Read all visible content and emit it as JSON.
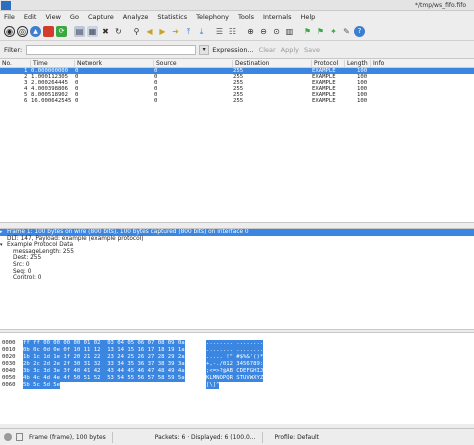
{
  "window": {
    "title": "*/tmp/ws_fifo.fifo"
  },
  "menu": [
    "File",
    "Edit",
    "View",
    "Go",
    "Capture",
    "Analyze",
    "Statistics",
    "Telephony",
    "Tools",
    "Internals",
    "Help"
  ],
  "toolbar": {
    "icons": [
      "interfaces-icon",
      "options-icon",
      "start-icon",
      "stop-icon",
      "restart-icon",
      "open-icon",
      "save-icon",
      "close-icon",
      "reload-icon",
      "print-icon",
      "find-icon",
      "back-icon",
      "forward-icon",
      "goto-icon",
      "first-icon",
      "last-icon",
      "colorize-icon",
      "autoscroll-icon",
      "zoom-in-icon",
      "zoom-out-icon",
      "zoom-100-icon",
      "resize-columns-icon",
      "capture-filters-icon",
      "display-filters-icon",
      "coloring-rules-icon",
      "preferences-icon",
      "help-icon"
    ],
    "colors": {
      "accent": "#2a6fc0",
      "stop": "#d23c2c",
      "start": "#3a7fd0",
      "green": "#3aa840"
    }
  },
  "filter": {
    "label": "Filter:",
    "value": "",
    "expression": "Expression...",
    "clear": "Clear",
    "apply": "Apply",
    "save": "Save"
  },
  "packet_list": {
    "columns": [
      "No.",
      "Time",
      "Network",
      "Source",
      "Destination",
      "Protocol",
      "Length",
      "Info"
    ],
    "rows": [
      {
        "no": "1",
        "time": "0.000000000",
        "network": "0",
        "source": "0",
        "destination": "255",
        "protocol": "EXAMPLE",
        "length": "100",
        "info": ""
      },
      {
        "no": "2",
        "time": "1.000112305",
        "network": "0",
        "source": "0",
        "destination": "255",
        "protocol": "EXAMPLE",
        "length": "100",
        "info": ""
      },
      {
        "no": "3",
        "time": "2.000264445",
        "network": "0",
        "source": "0",
        "destination": "255",
        "protocol": "EXAMPLE",
        "length": "100",
        "info": ""
      },
      {
        "no": "4",
        "time": "4.000398806",
        "network": "0",
        "source": "0",
        "destination": "255",
        "protocol": "EXAMPLE",
        "length": "100",
        "info": ""
      },
      {
        "no": "5",
        "time": "8.000518902",
        "network": "0",
        "source": "0",
        "destination": "255",
        "protocol": "EXAMPLE",
        "length": "100",
        "info": ""
      },
      {
        "no": "6",
        "time": "16.000642545",
        "network": "0",
        "source": "0",
        "destination": "255",
        "protocol": "EXAMPLE",
        "length": "100",
        "info": ""
      }
    ]
  },
  "details": {
    "lines": [
      {
        "text": "Frame 1: 100 bytes on wire (800 bits), 100 bytes captured (800 bits) on interface 0",
        "tri": "▸",
        "indent": 0
      },
      {
        "text": "DLT: 147, Payload: example (example protocol)",
        "tri": "",
        "indent": 1
      },
      {
        "text": "Example Protocol Data",
        "tri": "▾",
        "indent": 0
      },
      {
        "text": "messageLength: 255",
        "tri": "",
        "indent": 2
      },
      {
        "text": "Dest: 255",
        "tri": "",
        "indent": 2
      },
      {
        "text": "Src: 0",
        "tri": "",
        "indent": 2
      },
      {
        "text": "Seq: 0",
        "tri": "",
        "indent": 2
      },
      {
        "text": "Control: 0",
        "tri": "",
        "indent": 2
      }
    ]
  },
  "bytes": {
    "lines": [
      {
        "offset": "0000",
        "hex": "ff ff 00 00 00 00 01 02  03 04 05 06 07 08 09 0a",
        "ascii": "........ ........"
      },
      {
        "offset": "0010",
        "hex": "0b 0c 0d 0e 0f 10 11 12  13 14 15 16 17 18 19 1a",
        "ascii": "........ ........"
      },
      {
        "offset": "0020",
        "hex": "1b 1c 1d 1e 1f 20 21 22  23 24 25 26 27 28 29 2a",
        "ascii": "..... !\" #$%&'()*"
      },
      {
        "offset": "0030",
        "hex": "2b 2c 2d 2e 2f 30 31 32  33 34 35 36 37 38 39 3a",
        "ascii": "+,-./012 3456789:"
      },
      {
        "offset": "0040",
        "hex": "3b 3c 3d 3e 3f 40 41 42  43 44 45 46 47 48 49 4a",
        "ascii": ";<=>?@AB CDEFGHIJ"
      },
      {
        "offset": "0050",
        "hex": "4b 4c 4d 4e 4f 50 51 52  53 54 55 56 57 58 59 5a",
        "ascii": "KLMNOPQR STUVWXYZ"
      },
      {
        "offset": "0060",
        "hex": "5b 5c 5d 5e",
        "ascii": "[\\]^"
      }
    ]
  },
  "status": {
    "frame": "Frame (frame), 100 bytes",
    "packets": "Packets: 6 · Displayed: 6 (100.0...",
    "profile": "Profile: Default"
  }
}
